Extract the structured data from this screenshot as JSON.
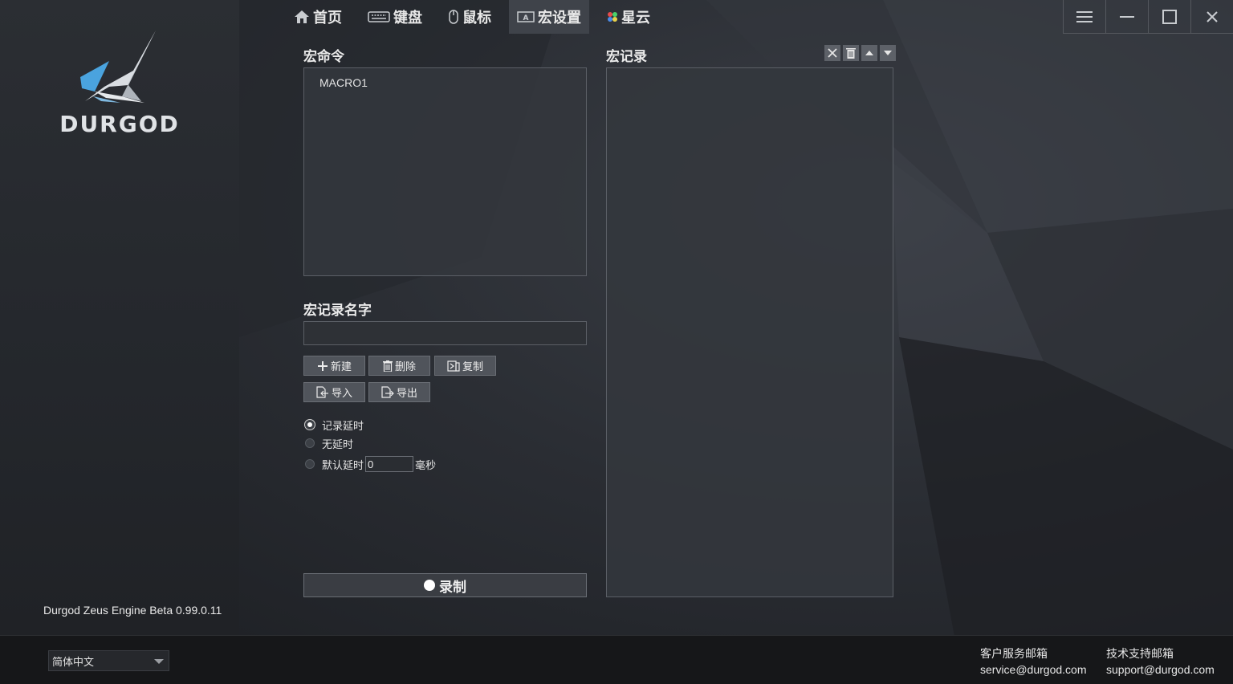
{
  "brand": {
    "logo_text": "DURGOD",
    "version": "Durgod Zeus Engine Beta 0.99.0.11"
  },
  "nav": {
    "items": [
      {
        "label": "首页",
        "icon": "home-icon"
      },
      {
        "label": "键盘",
        "icon": "keyboard-icon"
      },
      {
        "label": "鼠标",
        "icon": "mouse-icon"
      },
      {
        "label": "宏设置",
        "icon": "macro-icon",
        "active": true
      },
      {
        "label": "星云",
        "icon": "color-dots-icon"
      }
    ]
  },
  "window": {
    "menu": "☰",
    "minimize": "—",
    "maximize": "☐",
    "close": "✕"
  },
  "macro_commands": {
    "title": "宏命令",
    "items": [
      "MACRO1"
    ]
  },
  "macro_name": {
    "title": "宏记录名字",
    "value": "",
    "placeholder": ""
  },
  "buttons": {
    "new": "新建",
    "delete": "删除",
    "copy": "复制",
    "import": "导入",
    "export": "导出"
  },
  "delay_options": {
    "record_delay": "记录延时",
    "no_delay": "无延时",
    "default_delay": "默认延时",
    "default_value": "0",
    "unit": "毫秒",
    "selected": "record_delay"
  },
  "record": {
    "label": "录制"
  },
  "macro_records": {
    "title": "宏记录"
  },
  "footer": {
    "language": "简体中文",
    "service_label": "客户服务邮箱",
    "service_email": "service@durgod.com",
    "support_label": "技术支持邮箱",
    "support_email": "support@durgod.com"
  }
}
